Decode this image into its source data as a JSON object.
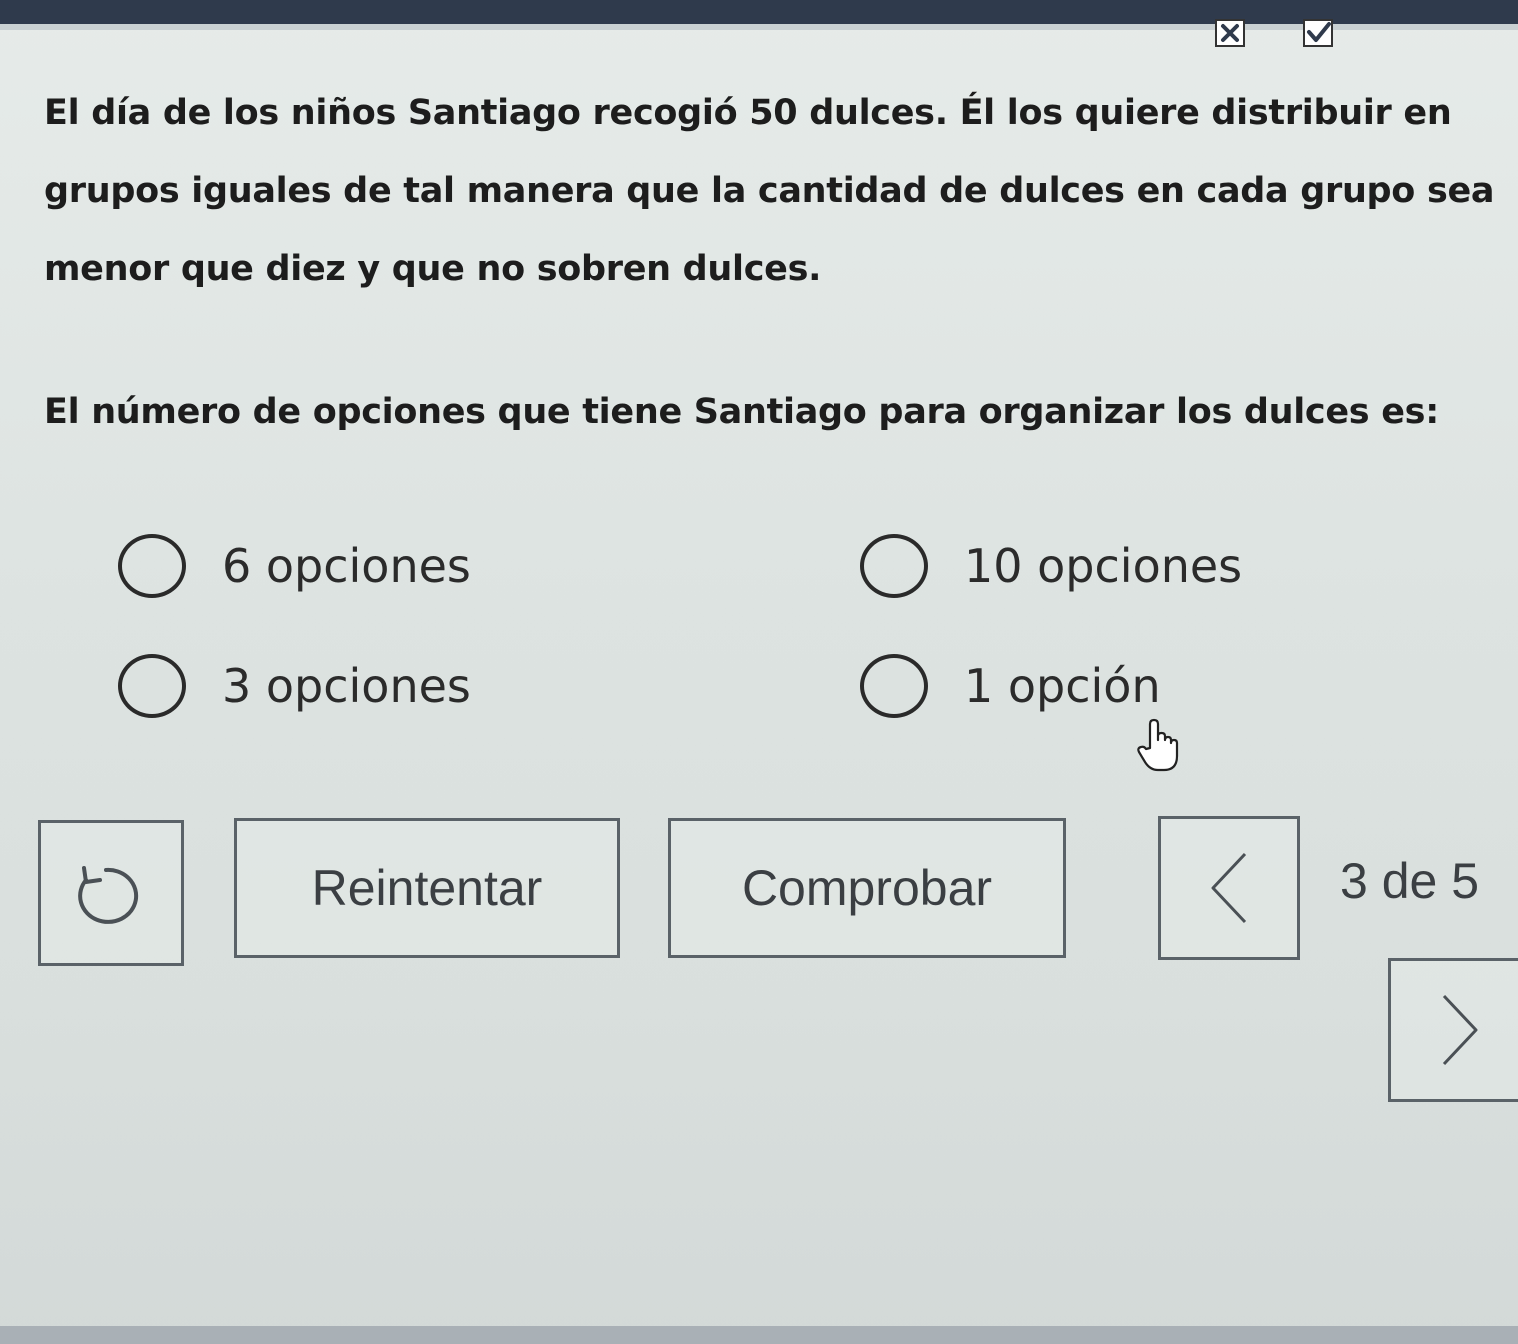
{
  "question": {
    "text": "El día de los niños Santiago recogió 50 dulces. Él los quiere distribuir en grupos iguales de tal manera que la cantidad de dulces en cada grupo sea menor que diez y que no sobren dulces.",
    "prompt": "El número de opciones que tiene Santiago para organizar los dulces es:"
  },
  "options": [
    {
      "label": "6 opciones",
      "selected": false
    },
    {
      "label": "10 opciones",
      "selected": false
    },
    {
      "label": "3 opciones",
      "selected": false
    },
    {
      "label": "1 opción",
      "selected": false
    }
  ],
  "buttons": {
    "retry": "Reintentar",
    "check": "Comprobar"
  },
  "pagination": {
    "current": 3,
    "total": 5,
    "label": "3 de 5"
  },
  "icons": {
    "top_status": [
      "close-icon",
      "check-icon"
    ],
    "undo": "undo-icon",
    "prev": "chevron-left-icon",
    "next": "chevron-right-icon",
    "cursor": "hand-cursor-icon"
  },
  "colors": {
    "top_bar": "#2f3a4c",
    "background": "#e2e7e5",
    "text": "#1d1d1d",
    "button_border": "#5a6268"
  }
}
